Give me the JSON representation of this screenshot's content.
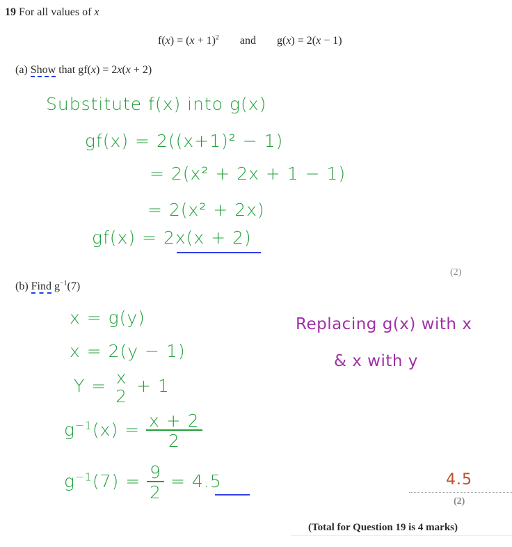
{
  "question": {
    "number": "19",
    "intro": "For all values of x",
    "intro_text": "For all values of ",
    "intro_var": "x",
    "definitions": {
      "f": "f(x) = (x + 1)²",
      "connector": "and",
      "g": "g(x) = 2(x − 1)"
    }
  },
  "part_a": {
    "label": "(a)",
    "command_word": "Show",
    "prompt_rest": "that gf(x) = 2x(x + 2)",
    "marks": "(2)",
    "working": [
      "Substitute  f(x)  into  g(x)",
      "gf(x)  =  2((x+1)² − 1)",
      "= 2(x² + 2x + 1 − 1)",
      "= 2(x² + 2x)",
      "gf(x)  =  2x(x + 2)"
    ],
    "final_answer": "2x(x + 2)"
  },
  "part_b": {
    "label": "(b)",
    "command_word": "Find",
    "prompt_rest": "g⁻¹(7)",
    "marks": "(2)",
    "working": [
      "x = g(y)",
      "x = 2(y − 1)",
      "y = x/2 + 1",
      "g⁻¹(x) = (x + 2)/2",
      "g⁻¹(7) = 9/2 = 4.5"
    ],
    "note_line1": "Replacing g(x) with x",
    "note_line2": "& x with y",
    "final_answer": "4.5",
    "answer_box_value": "4.5"
  },
  "total": "(Total for Question 19 is 4 marks)",
  "colors": {
    "working_green": "#22a03a",
    "note_purple": "#a030a8",
    "answer_red": "#c0502a",
    "underline_blue": "#3040e8",
    "command_word_underline": "#1f3ee6"
  }
}
